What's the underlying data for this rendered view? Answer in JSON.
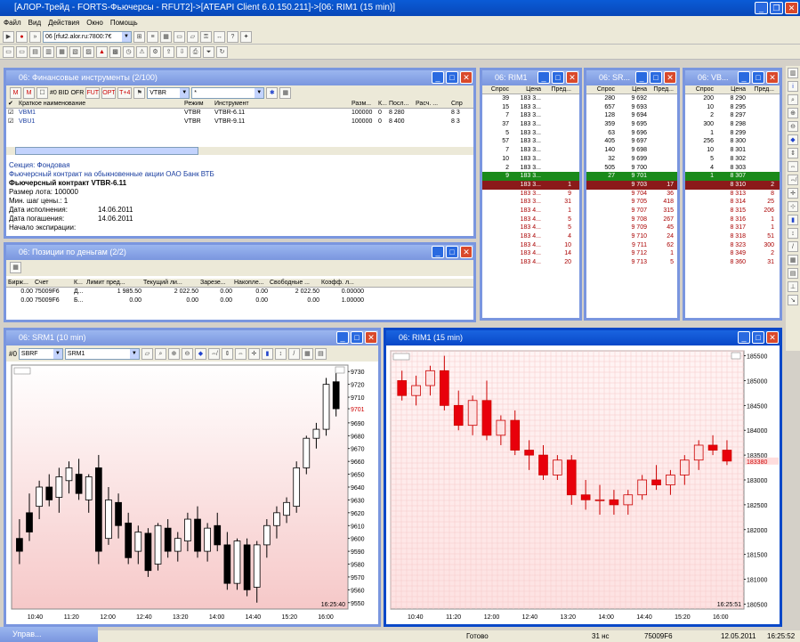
{
  "app_title": "[АЛОР-Трейд - FORTS-Фьючерсы - RFUT2]->[ATEAPI Client 6.0.150.211]->[06: RIM1 (15 min)]",
  "menu": [
    "Файл",
    "Вид",
    "Действия",
    "Окно",
    "Помощь"
  ],
  "toolbar": {
    "server_combo": "06 [rfut2.alor.ru:7800:7€"
  },
  "instruments": {
    "title": "06: Финансовые инструменты (2/100)",
    "filter_code": "VTBR",
    "filter_mask": "*",
    "buttons": [
      "#0",
      "BID",
      "OFR",
      "FUT",
      "OPT",
      "T+4"
    ],
    "columns": [
      "Краткое наименование",
      "Режим",
      "Инструмент",
      "Разм...",
      "К...",
      "Посл...",
      "Расч. ...",
      "Спр"
    ],
    "rows": [
      {
        "name": "VBM1",
        "mode": "VTBR",
        "instr": "VTBR-6.11",
        "lot": "100000",
        "k": "0",
        "last": "8 280",
        "calc": "",
        "spr": "8 3"
      },
      {
        "name": "VBU1",
        "mode": "VTBR",
        "instr": "VTBR-9.11",
        "lot": "100000",
        "k": "0",
        "last": "8 400",
        "calc": "",
        "spr": "8 3"
      }
    ],
    "info": {
      "section": "Секция: Фондовая",
      "desc": "Фьючерсный контракт на обыкновенные акции ОАО Банк ВТБ",
      "contract": "Фьючерсный контракт VTBR-6.11",
      "lot": "Размер лота: 100000",
      "step": "Мин. шаг цены.: 1",
      "exec_label": "Дата исполнения:",
      "exec_val": "14.06.2011",
      "close_label": "Дата погашения:",
      "close_val": "14.06.2011",
      "start_label": "Начало экспирации:"
    }
  },
  "positions": {
    "title": "06: Позиции по деньгам (2/2)",
    "columns": [
      "Бирж...",
      "Счет",
      "К...",
      "Лимит пред...",
      "Текущий ли...",
      "Зарезе...",
      "Накопле...",
      "Свободные ...",
      "Коэфф. л..."
    ],
    "rows": [
      [
        "0.00",
        "75009F6",
        "Д...",
        "1 985.50",
        "2 022.50",
        "0.00",
        "0.00",
        "2 022.50",
        "0.00000"
      ],
      [
        "0.00",
        "75009F6",
        "Б...",
        "0.00",
        "0.00",
        "0.00",
        "0.00",
        "0.00",
        "1.00000"
      ]
    ]
  },
  "ob_rim": {
    "title": "06: RIM1",
    "cols": [
      "Спрос",
      "Цена",
      "Пред..."
    ],
    "rows": [
      [
        "39",
        "183 3...",
        ""
      ],
      [
        "15",
        "183 3...",
        ""
      ],
      [
        "7",
        "183 3...",
        ""
      ],
      [
        "37",
        "183 3...",
        ""
      ],
      [
        "5",
        "183 3...",
        ""
      ],
      [
        "57",
        "183 3...",
        ""
      ],
      [
        "7",
        "183 3...",
        ""
      ],
      [
        "10",
        "183 3...",
        ""
      ],
      [
        "2",
        "183 3...",
        ""
      ],
      [
        "9",
        "183 3...",
        "",
        "g"
      ],
      [
        "",
        "183 3...",
        "1",
        "m"
      ],
      [
        "",
        "183 3...",
        "9"
      ],
      [
        "",
        "183 3...",
        "31"
      ],
      [
        "",
        "183 4...",
        "1"
      ],
      [
        "",
        "183 4...",
        "5"
      ],
      [
        "",
        "183 4...",
        "5"
      ],
      [
        "",
        "183 4...",
        "4"
      ],
      [
        "",
        "183 4...",
        "10"
      ],
      [
        "",
        "183 4...",
        "14"
      ],
      [
        "",
        "183 4...",
        "20"
      ]
    ]
  },
  "ob_sr": {
    "title": "06: SR...",
    "cols": [
      "Спрос",
      "Цена",
      "Пред..."
    ],
    "rows": [
      [
        "280",
        "9 692",
        ""
      ],
      [
        "657",
        "9 693",
        ""
      ],
      [
        "128",
        "9 694",
        ""
      ],
      [
        "359",
        "9 695",
        ""
      ],
      [
        "63",
        "9 696",
        ""
      ],
      [
        "405",
        "9 697",
        ""
      ],
      [
        "140",
        "9 698",
        ""
      ],
      [
        "32",
        "9 699",
        ""
      ],
      [
        "505",
        "9 700",
        ""
      ],
      [
        "27",
        "9 701",
        "",
        "g"
      ],
      [
        "",
        "9 703",
        "17",
        "m"
      ],
      [
        "",
        "9 704",
        "36"
      ],
      [
        "",
        "9 705",
        "418"
      ],
      [
        "",
        "9 707",
        "315"
      ],
      [
        "",
        "9 708",
        "267"
      ],
      [
        "",
        "9 709",
        "45"
      ],
      [
        "",
        "9 710",
        "24"
      ],
      [
        "",
        "9 711",
        "62"
      ],
      [
        "",
        "9 712",
        "1"
      ],
      [
        "",
        "9 713",
        "5"
      ]
    ]
  },
  "ob_vb": {
    "title": "06: VB...",
    "cols": [
      "Спрос",
      "Цена",
      "Пред..."
    ],
    "rows": [
      [
        "200",
        "8 290",
        ""
      ],
      [
        "10",
        "8 295",
        ""
      ],
      [
        "2",
        "8 297",
        ""
      ],
      [
        "300",
        "8 298",
        ""
      ],
      [
        "1",
        "8 299",
        ""
      ],
      [
        "256",
        "8 300",
        ""
      ],
      [
        "10",
        "8 301",
        ""
      ],
      [
        "5",
        "8 302",
        ""
      ],
      [
        "4",
        "8 303",
        ""
      ],
      [
        "1",
        "8 307",
        "",
        "g"
      ],
      [
        "",
        "8 310",
        "2",
        "m"
      ],
      [
        "",
        "8 313",
        "8"
      ],
      [
        "",
        "8 314",
        "25"
      ],
      [
        "",
        "8 315",
        "206"
      ],
      [
        "",
        "8 316",
        "1"
      ],
      [
        "",
        "8 317",
        "1"
      ],
      [
        "",
        "8 318",
        "51"
      ],
      [
        "",
        "8 323",
        "300"
      ],
      [
        "",
        "8 349",
        "2"
      ],
      [
        "",
        "8 360",
        "31"
      ]
    ]
  },
  "chart_sr": {
    "title": "06: SRM1 (10 min)",
    "code": "SBRF",
    "instr": "SRM1",
    "counter": "#0",
    "time": "16:25:40",
    "last_label": "9701",
    "y_ticks": [
      "9730",
      "9720",
      "9710",
      "9701",
      "9690",
      "9680",
      "9670",
      "9660",
      "9650",
      "9640",
      "9630",
      "9620",
      "9610",
      "9600",
      "9590",
      "9580",
      "9570",
      "9560",
      "9550"
    ],
    "x_ticks": [
      "10:40",
      "11:20",
      "12:00",
      "12:40",
      "13:20",
      "14:00",
      "14:40",
      "15:20",
      "16:00"
    ]
  },
  "chart_ri": {
    "title": "06: RIM1 (15 min)",
    "time": "16:25:51",
    "last_label": "183380",
    "y_ticks": [
      "185500",
      "185000",
      "184500",
      "184000",
      "183500",
      "183000",
      "182500",
      "182000",
      "181500",
      "181000",
      "180500"
    ],
    "x_ticks": [
      "10:40",
      "11:20",
      "12:00",
      "12:40",
      "13:20",
      "14:00",
      "14:40",
      "15:20",
      "16:00"
    ]
  },
  "chart_data": [
    {
      "type": "candlestick",
      "title": "06: SRM1 (10 min)",
      "ylim": [
        9545,
        9735
      ],
      "last": 9701,
      "candles": [
        [
          9600,
          9615,
          9580,
          9590
        ],
        [
          9620,
          9635,
          9598,
          9605
        ],
        [
          9625,
          9645,
          9615,
          9640
        ],
        [
          9640,
          9650,
          9625,
          9630
        ],
        [
          9632,
          9655,
          9620,
          9648
        ],
        [
          9645,
          9660,
          9635,
          9655
        ],
        [
          9650,
          9662,
          9630,
          9635
        ],
        [
          9630,
          9650,
          9620,
          9648
        ],
        [
          9655,
          9665,
          9580,
          9590
        ],
        [
          9600,
          9640,
          9595,
          9630
        ],
        [
          9628,
          9635,
          9600,
          9610
        ],
        [
          9612,
          9620,
          9580,
          9585
        ],
        [
          9590,
          9610,
          9580,
          9605
        ],
        [
          9604,
          9608,
          9570,
          9575
        ],
        [
          9580,
          9612,
          9575,
          9610
        ],
        [
          9608,
          9615,
          9585,
          9590
        ],
        [
          9590,
          9605,
          9582,
          9600
        ],
        [
          9598,
          9620,
          9590,
          9615
        ],
        [
          9615,
          9625,
          9585,
          9590
        ],
        [
          9590,
          9612,
          9582,
          9608
        ],
        [
          9610,
          9620,
          9590,
          9595
        ],
        [
          9595,
          9605,
          9560,
          9565
        ],
        [
          9565,
          9600,
          9560,
          9598
        ],
        [
          9595,
          9600,
          9555,
          9560
        ],
        [
          9562,
          9598,
          9550,
          9595
        ],
        [
          9595,
          9615,
          9585,
          9610
        ],
        [
          9610,
          9625,
          9600,
          9620
        ],
        [
          9618,
          9632,
          9612,
          9628
        ],
        [
          9625,
          9660,
          9620,
          9655
        ],
        [
          9655,
          9680,
          9650,
          9678
        ],
        [
          9678,
          9690,
          9670,
          9685
        ],
        [
          9685,
          9725,
          9680,
          9720
        ],
        [
          9722,
          9730,
          9695,
          9701
        ]
      ]
    },
    {
      "type": "candlestick",
      "title": "06: RIM1 (15 min)",
      "ylim": [
        180400,
        185600
      ],
      "last": 183380,
      "candles": [
        [
          185000,
          185200,
          184600,
          184700
        ],
        [
          184700,
          185100,
          184500,
          184900
        ],
        [
          184900,
          185300,
          184700,
          185200
        ],
        [
          185200,
          185500,
          184400,
          184500
        ],
        [
          184500,
          184800,
          184000,
          184100
        ],
        [
          184100,
          184700,
          183900,
          184600
        ],
        [
          184600,
          185000,
          183800,
          183900
        ],
        [
          183900,
          184300,
          183700,
          184200
        ],
        [
          184200,
          184400,
          183500,
          183600
        ],
        [
          183600,
          183800,
          183200,
          183500
        ],
        [
          183500,
          183700,
          183000,
          183100
        ],
        [
          183100,
          183500,
          183000,
          183400
        ],
        [
          183400,
          183500,
          182500,
          182700
        ],
        [
          182700,
          183000,
          182400,
          182600
        ],
        [
          182600,
          182900,
          182300,
          182600
        ],
        [
          182600,
          182800,
          182300,
          182500
        ],
        [
          182500,
          182800,
          182300,
          182700
        ],
        [
          182700,
          183100,
          182600,
          183000
        ],
        [
          183000,
          183300,
          182800,
          182900
        ],
        [
          182900,
          183200,
          182700,
          183100
        ],
        [
          183100,
          183500,
          182900,
          183400
        ],
        [
          183400,
          183800,
          183200,
          183700
        ],
        [
          183700,
          183900,
          183500,
          183600
        ],
        [
          183600,
          183800,
          183300,
          183380
        ]
      ]
    }
  ],
  "taskbar": {
    "label": "Управ..."
  },
  "status": {
    "ready": "Готово",
    "signal": "31 нс",
    "account": "75009F6",
    "date": "12.05.2011",
    "time": "16:25:52"
  }
}
